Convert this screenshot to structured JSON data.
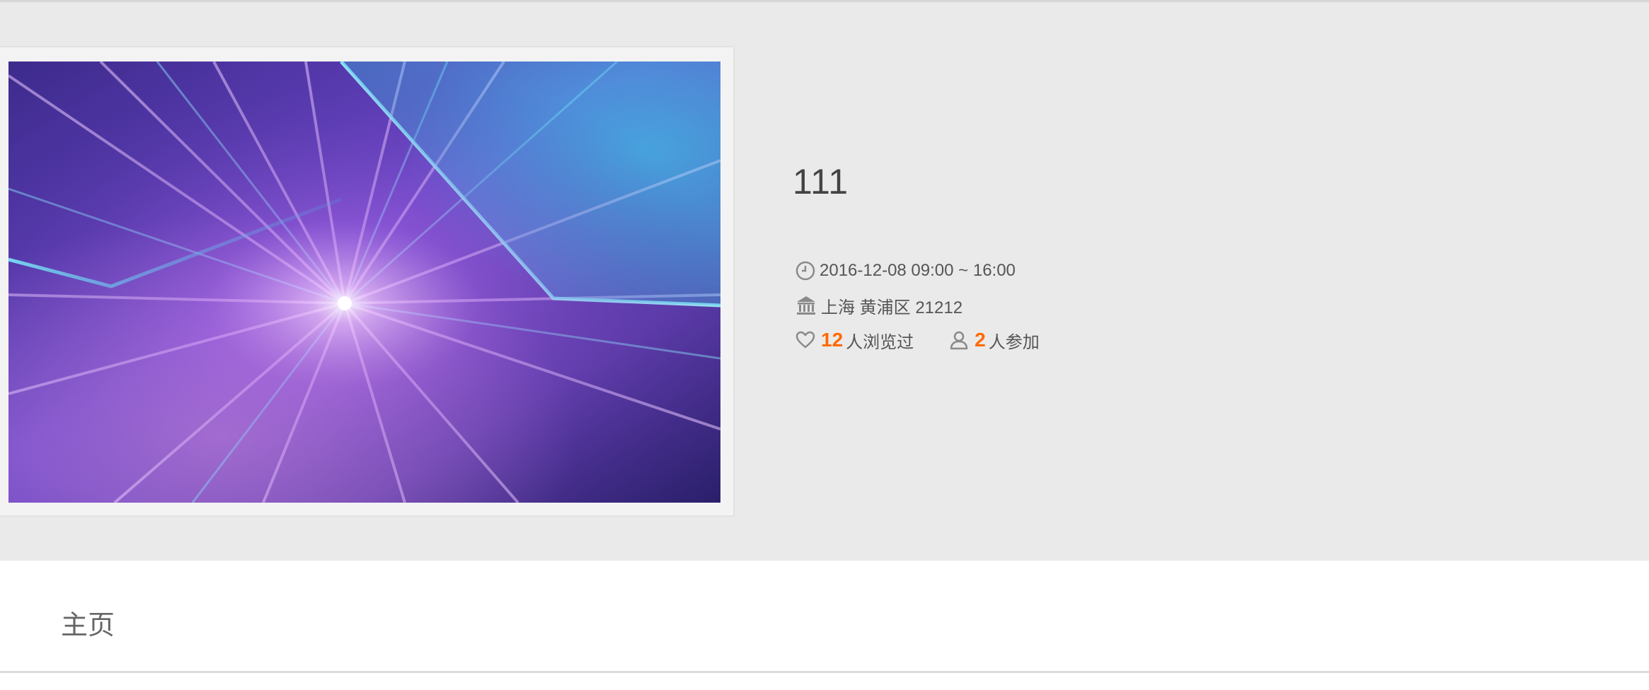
{
  "event": {
    "title": "111",
    "datetime": "2016-12-08 09:00 ~ 16:00",
    "location": "上海 黄浦区 21212",
    "views_count": "12",
    "views_label": "人浏览过",
    "participants_count": "2",
    "participants_label": "人参加"
  },
  "icons": {
    "time": "clock-icon",
    "location": "building-icon",
    "views": "heart-icon",
    "participants": "person-icon"
  },
  "nav": {
    "tabs": [
      {
        "label": "主页"
      }
    ]
  },
  "colors": {
    "hero_background": "#eaeaea",
    "accent": "#ff6a00",
    "text": "#555555",
    "title": "#444444"
  }
}
